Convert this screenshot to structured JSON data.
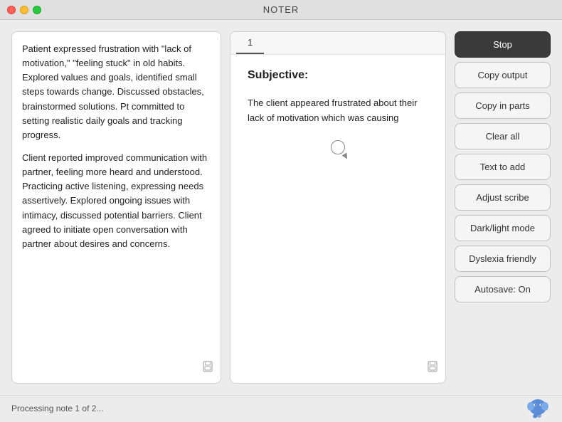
{
  "app": {
    "title": "NOTER"
  },
  "left_panel": {
    "text": "Patient expressed frustration with \"lack of motivation,\" \"feeling stuck\" in old habits. Explored values and goals, identified small steps towards change. Discussed obstacles, brainstormed solutions. Pt committed to setting realistic daily goals and tracking progress.\n\nClient reported improved communication with partner, feeling more heard and understood. Practicing active listening, expressing needs assertively. Explored ongoing issues with intimacy, discussed potential barriers. Client agreed to initiate open conversation with partner about desires and concerns."
  },
  "center_panel": {
    "tab_label": "1",
    "section_heading": "Subjective:",
    "output_text": "The client appeared frustrated about their lack of motivation which was causing"
  },
  "buttons": {
    "stop": "Stop",
    "copy_output": "Copy output",
    "copy_parts": "Copy in parts",
    "clear_all": "Clear all",
    "text_to_add": "Text to add",
    "adjust_scribe": "Adjust scribe",
    "dark_light": "Dark/light mode",
    "dyslexia": "Dyslexia friendly",
    "autosave": "Autosave: On"
  },
  "status_bar": {
    "text": "Processing note 1 of 2..."
  }
}
